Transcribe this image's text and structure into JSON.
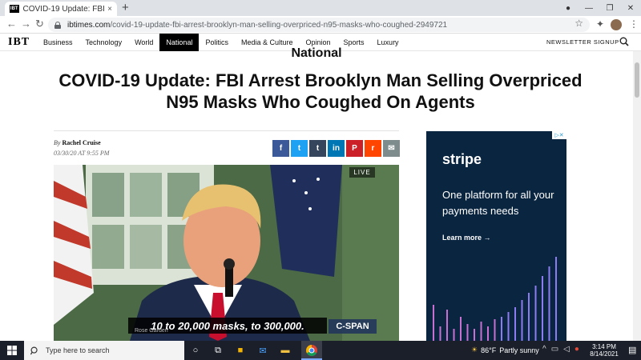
{
  "browser": {
    "tab_title": "COVID-19 Update: FBI Arrest Bro...",
    "tab_favicon_text": "IBT",
    "url_host": "ibtimes.com",
    "url_path": "/covid-19-update-fbi-arrest-brooklyn-man-selling-overpriced-n95-masks-who-coughed-2949721",
    "new_tab_glyph": "+",
    "close_glyph": "×"
  },
  "site": {
    "logo": "IBT",
    "nav": [
      "Business",
      "Technology",
      "World",
      "National",
      "Politics",
      "Media & Culture",
      "Opinion",
      "Sports",
      "Luxury"
    ],
    "active_nav": "National",
    "newsletter": "NEWSLETTER SIGNUP"
  },
  "article": {
    "section": "National",
    "headline": "COVID-19 Update: FBI Arrest Brooklyn Man Selling Overpriced N95 Masks Who Coughed On Agents",
    "by_prefix": "By",
    "author": "Rachel Cruise",
    "date": "03/30/20 AT 9:55 PM",
    "share_icons": [
      {
        "name": "facebook",
        "glyph": "f",
        "color": "#3b5998"
      },
      {
        "name": "twitter",
        "glyph": "t",
        "color": "#1da1f2"
      },
      {
        "name": "tumblr",
        "glyph": "t",
        "color": "#35465c"
      },
      {
        "name": "linkedin",
        "glyph": "in",
        "color": "#0077b5"
      },
      {
        "name": "pinterest",
        "glyph": "P",
        "color": "#cb2027"
      },
      {
        "name": "reddit",
        "glyph": "r",
        "color": "#ff4500"
      },
      {
        "name": "email",
        "glyph": "✉",
        "color": "#7f8c8d"
      }
    ]
  },
  "video": {
    "live_label": "LIVE",
    "caption": "10 to 20,000 masks, to 300,000.",
    "location": "Rose Garden",
    "network": "C-SPAN"
  },
  "ad": {
    "brand": "stripe",
    "headline": "One platform for all your payments needs",
    "cta": "Learn more →",
    "bar_heights": [
      0.3,
      0.12,
      0.26,
      0.1,
      0.2,
      0.14,
      0.1,
      0.16,
      0.12,
      0.18,
      0.2,
      0.24,
      0.28,
      0.34,
      0.4,
      0.46,
      0.54,
      0.62,
      0.7
    ]
  },
  "taskbar": {
    "search_placeholder": "Type here to search",
    "weather_temp": "86°F",
    "weather_desc": "Partly sunny",
    "time": "3:14 PM",
    "date": "8/14/2021"
  }
}
